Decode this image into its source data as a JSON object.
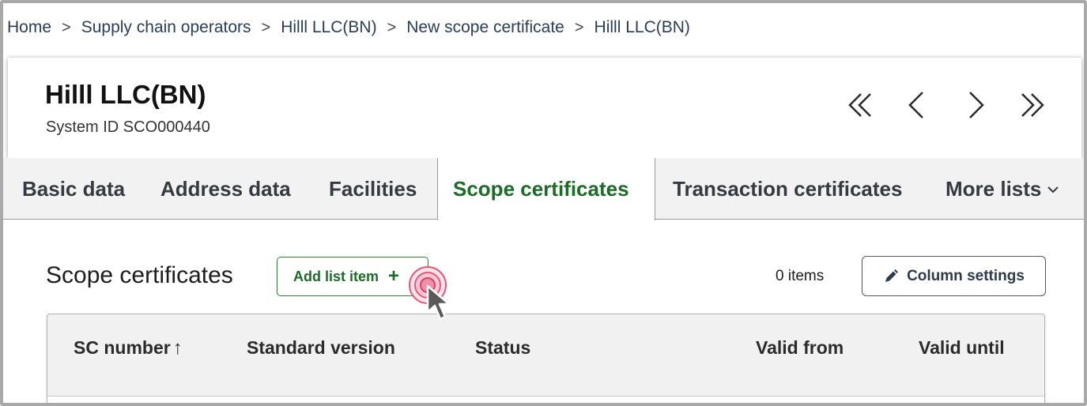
{
  "breadcrumb": {
    "items": [
      "Home",
      "Supply chain operators",
      "Hilll LLC(BN)",
      "New scope certificate",
      "Hilll LLC(BN)"
    ],
    "separator": ">"
  },
  "header": {
    "title": "Hilll LLC(BN)",
    "subtitle": "System ID SCO000440",
    "nav": {
      "first": "first-page-icon",
      "prev": "previous-icon",
      "next": "next-icon",
      "last": "last-page-icon"
    }
  },
  "tabs": [
    {
      "label": "Basic data",
      "active": false
    },
    {
      "label": "Address data",
      "active": false
    },
    {
      "label": "Facilities",
      "active": false
    },
    {
      "label": "Scope certificates",
      "active": true
    },
    {
      "label": "Transaction certificates",
      "active": false
    },
    {
      "label": "More lists",
      "active": false
    }
  ],
  "main": {
    "section_title": "Scope certificates",
    "add_button": "Add list item",
    "add_icon": "+",
    "items_count": "0 items",
    "column_settings": "Column settings"
  },
  "table": {
    "columns": [
      "SC number",
      "Standard version",
      "Status",
      "Valid from",
      "Valid until"
    ],
    "sort_indicator": "↑",
    "rows": []
  },
  "colors": {
    "accent_green": "#1c6b27",
    "breadcrumb_text": "#2b3e57",
    "click_ring": "#e05b7a"
  }
}
